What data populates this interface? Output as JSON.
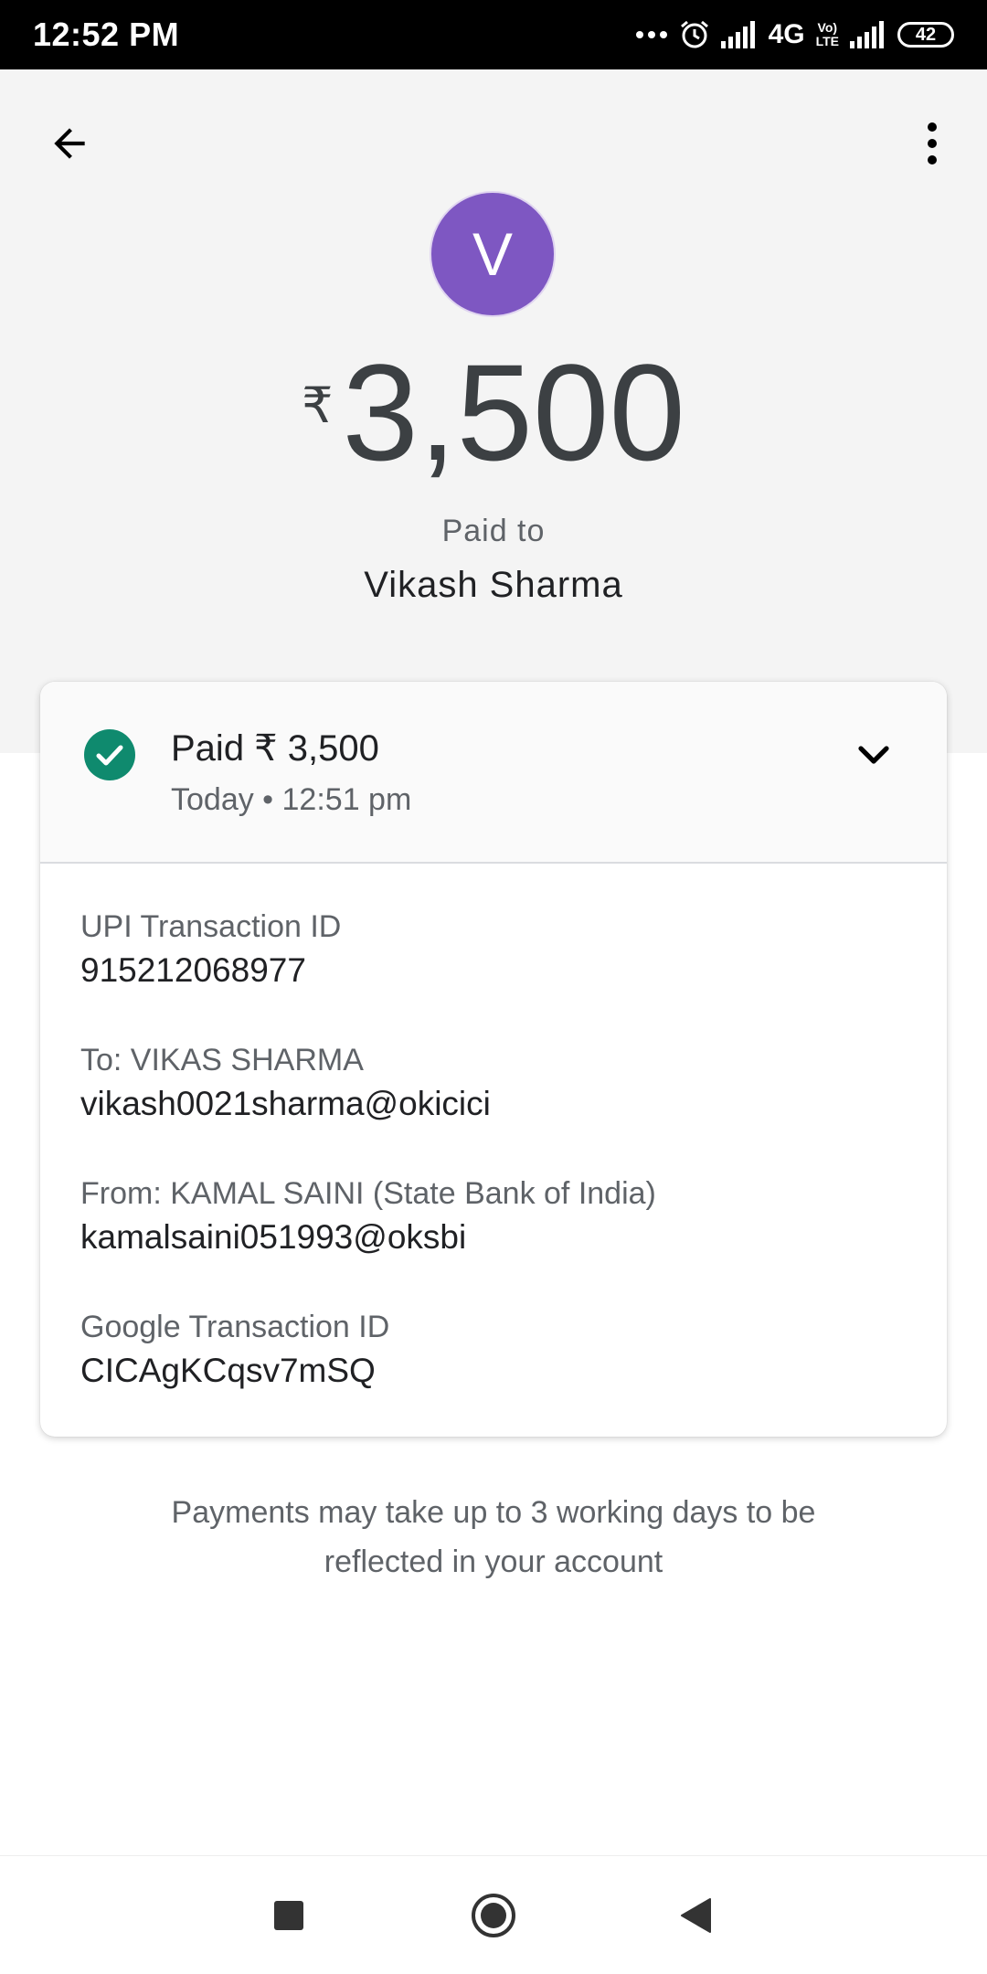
{
  "status_bar": {
    "time": "12:52 PM",
    "network": "4G",
    "volte_top": "Vo)",
    "volte_bottom": "LTE",
    "battery": "42"
  },
  "header": {
    "avatar_letter": "V",
    "currency_symbol": "₹",
    "amount": "3,500",
    "paid_to_label": "Paid to",
    "payee_name": "Vikash Sharma"
  },
  "card": {
    "status_title": "Paid ₹ 3,500",
    "status_time": "Today • 12:51 pm",
    "details": [
      {
        "label": "UPI Transaction ID",
        "value": "915212068977"
      },
      {
        "label": "To: VIKAS  SHARMA",
        "value": "vikash0021sharma@okicici"
      },
      {
        "label": "From: KAMAL  SAINI (State Bank of India)",
        "value": "kamalsaini051993@oksbi"
      },
      {
        "label": "Google Transaction ID",
        "value": "CICAgKCqsv7mSQ"
      }
    ]
  },
  "notice": "Payments may take up to 3 working days to be reflected in your account",
  "icons": {
    "back": "arrow-back-icon",
    "more": "more-vert-icon",
    "check": "check-circle-icon",
    "chevron": "chevron-down-icon",
    "nav_recents": "square-icon",
    "nav_home": "circle-icon",
    "nav_back": "triangle-back-icon"
  },
  "colors": {
    "accent_success": "#0f8a6e",
    "avatar_bg": "#7e57c2",
    "header_bg": "#f4f4f4"
  }
}
